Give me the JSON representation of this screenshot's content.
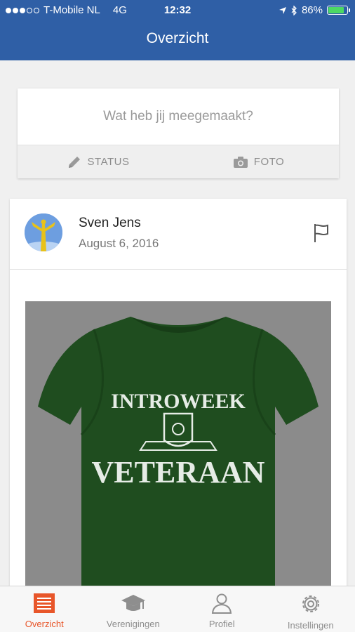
{
  "statusbar": {
    "carrier": "T-Mobile NL",
    "network": "4G",
    "time": "12:32",
    "battery": "86%",
    "battery_level": 0.86
  },
  "header": {
    "title": "Overzicht"
  },
  "composer": {
    "placeholder": "Wat heb jij meegemaakt?",
    "status_label": "STATUS",
    "photo_label": "FOTO"
  },
  "post": {
    "author": "Sven Jens",
    "date": "August 6, 2016",
    "shirt_text_top": "INTROWEEK",
    "shirt_text_bottom": "VETERAAN"
  },
  "tabs": [
    {
      "label": "Overzicht",
      "icon": "list-icon",
      "active": true
    },
    {
      "label": "Verenigingen",
      "icon": "graduation-cap-icon",
      "active": false
    },
    {
      "label": "Profiel",
      "icon": "person-icon",
      "active": false
    },
    {
      "label": "Instellingen",
      "icon": "gear-icon",
      "active": false
    }
  ],
  "colors": {
    "header": "#2f5fa6",
    "active_tab": "#e8562a",
    "inactive_tab": "#8e8e8e",
    "shirt": "#1f4d1f"
  }
}
